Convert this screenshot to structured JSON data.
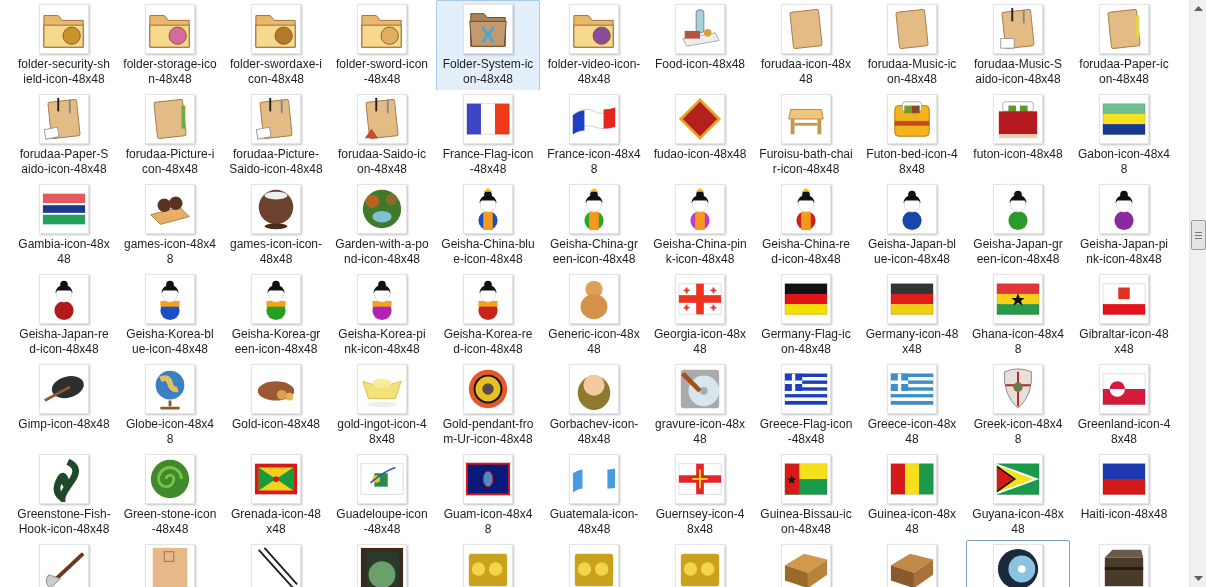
{
  "items": [
    {
      "label": "folder-security-shield-icon-48x48",
      "selected": false,
      "focused": false
    },
    {
      "label": "folder-storage-icon-48x48",
      "selected": false,
      "focused": false
    },
    {
      "label": "folder-swordaxe-icon-48x48",
      "selected": false,
      "focused": false
    },
    {
      "label": "folder-sword-icon-48x48",
      "selected": false,
      "focused": false
    },
    {
      "label": "Folder-System-icon-48x48",
      "selected": true,
      "focused": false
    },
    {
      "label": "folder-video-icon-48x48",
      "selected": false,
      "focused": false
    },
    {
      "label": "Food-icon-48x48",
      "selected": false,
      "focused": false
    },
    {
      "label": "forudaa-icon-48x48",
      "selected": false,
      "focused": false
    },
    {
      "label": "forudaa-Music-icon-48x48",
      "selected": false,
      "focused": false
    },
    {
      "label": "forudaa-Music-Saido-icon-48x48",
      "selected": false,
      "focused": false
    },
    {
      "label": "forudaa-Paper-icon-48x48",
      "selected": false,
      "focused": false
    },
    {
      "label": "forudaa-Paper-Saido-icon-48x48",
      "selected": false,
      "focused": false
    },
    {
      "label": "forudaa-Picture-icon-48x48",
      "selected": false,
      "focused": false
    },
    {
      "label": "forudaa-Picture-Saido-icon-48x48",
      "selected": false,
      "focused": false
    },
    {
      "label": "forudaa-Saido-icon-48x48",
      "selected": false,
      "focused": false
    },
    {
      "label": "France-Flag-icon-48x48",
      "selected": false,
      "focused": false
    },
    {
      "label": "France-icon-48x48",
      "selected": false,
      "focused": false
    },
    {
      "label": "fudao-icon-48x48",
      "selected": false,
      "focused": false
    },
    {
      "label": "Furoisu-bath-chair-icon-48x48",
      "selected": false,
      "focused": false
    },
    {
      "label": "Futon-bed-icon-48x48",
      "selected": false,
      "focused": false
    },
    {
      "label": "futon-icon-48x48",
      "selected": false,
      "focused": false
    },
    {
      "label": "Gabon-icon-48x48",
      "selected": false,
      "focused": false
    },
    {
      "label": "Gambia-icon-48x48",
      "selected": false,
      "focused": false
    },
    {
      "label": "games-icon-48x48",
      "selected": false,
      "focused": false
    },
    {
      "label": "games-icon-icon-48x48",
      "selected": false,
      "focused": false
    },
    {
      "label": "Garden-with-a-pond-icon-48x48",
      "selected": false,
      "focused": false
    },
    {
      "label": "Geisha-China-blue-icon-48x48",
      "selected": false,
      "focused": false
    },
    {
      "label": "Geisha-China-green-icon-48x48",
      "selected": false,
      "focused": false
    },
    {
      "label": "Geisha-China-pink-icon-48x48",
      "selected": false,
      "focused": false
    },
    {
      "label": "Geisha-China-red-icon-48x48",
      "selected": false,
      "focused": false
    },
    {
      "label": "Geisha-Japan-blue-icon-48x48",
      "selected": false,
      "focused": false
    },
    {
      "label": "Geisha-Japan-green-icon-48x48",
      "selected": false,
      "focused": false
    },
    {
      "label": "Geisha-Japan-pink-icon-48x48",
      "selected": false,
      "focused": false
    },
    {
      "label": "Geisha-Japan-red-icon-48x48",
      "selected": false,
      "focused": false
    },
    {
      "label": "Geisha-Korea-blue-icon-48x48",
      "selected": false,
      "focused": false
    },
    {
      "label": "Geisha-Korea-green-icon-48x48",
      "selected": false,
      "focused": false
    },
    {
      "label": "Geisha-Korea-pink-icon-48x48",
      "selected": false,
      "focused": false
    },
    {
      "label": "Geisha-Korea-red-icon-48x48",
      "selected": false,
      "focused": false
    },
    {
      "label": "Generic-icon-48x48",
      "selected": false,
      "focused": false
    },
    {
      "label": "Georgia-icon-48x48",
      "selected": false,
      "focused": false
    },
    {
      "label": "Germany-Flag-icon-48x48",
      "selected": false,
      "focused": false
    },
    {
      "label": "Germany-icon-48x48",
      "selected": false,
      "focused": false
    },
    {
      "label": "Ghana-icon-48x48",
      "selected": false,
      "focused": false
    },
    {
      "label": "Gibraltar-icon-48x48",
      "selected": false,
      "focused": false
    },
    {
      "label": "Gimp-icon-48x48",
      "selected": false,
      "focused": false
    },
    {
      "label": "Globe-icon-48x48",
      "selected": false,
      "focused": false
    },
    {
      "label": "Gold-icon-48x48",
      "selected": false,
      "focused": false
    },
    {
      "label": "gold-ingot-icon-48x48",
      "selected": false,
      "focused": false
    },
    {
      "label": "Gold-pendant-from-Ur-icon-48x48",
      "selected": false,
      "focused": false
    },
    {
      "label": "Gorbachev-icon-48x48",
      "selected": false,
      "focused": false
    },
    {
      "label": "gravure-icon-48x48",
      "selected": false,
      "focused": false
    },
    {
      "label": "Greece-Flag-icon-48x48",
      "selected": false,
      "focused": false
    },
    {
      "label": "Greece-icon-48x48",
      "selected": false,
      "focused": false
    },
    {
      "label": "Greek-icon-48x48",
      "selected": false,
      "focused": false
    },
    {
      "label": "Greenland-icon-48x48",
      "selected": false,
      "focused": false
    },
    {
      "label": "Greenstone-Fish-Hook-icon-48x48",
      "selected": false,
      "focused": false
    },
    {
      "label": "Green-stone-icon-48x48",
      "selected": false,
      "focused": false
    },
    {
      "label": "Grenada-icon-48x48",
      "selected": false,
      "focused": false
    },
    {
      "label": "Guadeloupe-icon-48x48",
      "selected": false,
      "focused": false
    },
    {
      "label": "Guam-icon-48x48",
      "selected": false,
      "focused": false
    },
    {
      "label": "Guatemala-icon-48x48",
      "selected": false,
      "focused": false
    },
    {
      "label": "Guernsey-icon-48x48",
      "selected": false,
      "focused": false
    },
    {
      "label": "Guinea-Bissau-icon-48x48",
      "selected": false,
      "focused": false
    },
    {
      "label": "Guinea-icon-48x48",
      "selected": false,
      "focused": false
    },
    {
      "label": "Guyana-icon-48x48",
      "selected": false,
      "focused": false
    },
    {
      "label": "Haiti-icon-48x48",
      "selected": false,
      "focused": false
    },
    {
      "selected": false,
      "focused": false
    },
    {
      "selected": false,
      "focused": false
    },
    {
      "selected": false,
      "focused": false
    },
    {
      "selected": false,
      "focused": false
    },
    {
      "selected": false,
      "focused": false
    },
    {
      "selected": false,
      "focused": false
    },
    {
      "selected": false,
      "focused": false
    },
    {
      "selected": false,
      "focused": false
    },
    {
      "selected": false,
      "focused": false
    },
    {
      "selected": false,
      "focused": true
    },
    {
      "selected": false,
      "focused": false
    }
  ]
}
